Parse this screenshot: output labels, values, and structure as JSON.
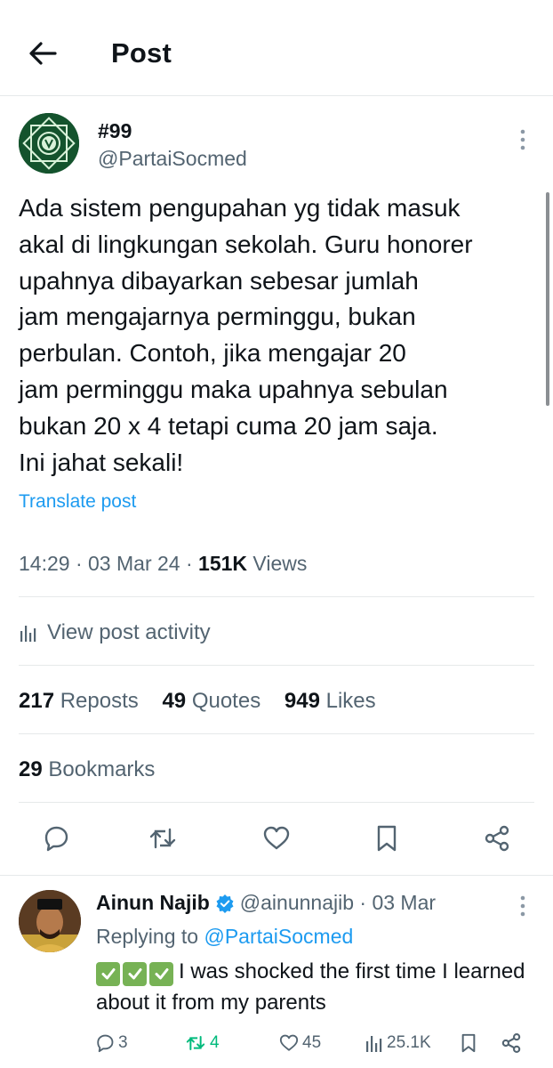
{
  "header": {
    "title": "Post",
    "back_icon": "arrow-left-icon"
  },
  "post": {
    "author_name": "#99",
    "author_handle": "@PartaiSocmed",
    "avatar_icon": "party-emblem-icon",
    "text_lines": [
      "Ada sistem pengupahan yg tidak masuk",
      "akal di lingkungan sekolah. Guru honorer",
      "upahnya dibayarkan sebesar jumlah",
      "jam mengajarnya perminggu, bukan",
      "perbulan. Contoh, jika mengajar 20",
      "jam perminggu maka upahnya sebulan",
      "bukan 20 x 4 tetapi cuma 20 jam saja.",
      "Ini jahat sekali!"
    ],
    "translate_label": "Translate post",
    "time": "14:29",
    "date": "03 Mar 24",
    "views_count": "151K",
    "views_label": "Views",
    "activity_label": "View post activity",
    "reposts_count": "217",
    "reposts_label": "Reposts",
    "quotes_count": "49",
    "quotes_label": "Quotes",
    "likes_count": "949",
    "likes_label": "Likes",
    "bookmarks_count": "29",
    "bookmarks_label": "Bookmarks"
  },
  "reply": {
    "author_name": "Ainun Najib",
    "author_handle": "@ainunnajib",
    "date": "03 Mar",
    "replying_prefix": "Replying to",
    "replying_to": "@PartaiSocmed",
    "text": "I was shocked the first time I learned about it from my parents",
    "replies_count": "3",
    "reposts_count": "4",
    "likes_count": "45",
    "views_count": "25.1K"
  },
  "colors": {
    "accent": "#1d9bf0",
    "secondary_text": "#536471",
    "repost_green": "#00ba7c",
    "emblem_green": "#14532d"
  }
}
